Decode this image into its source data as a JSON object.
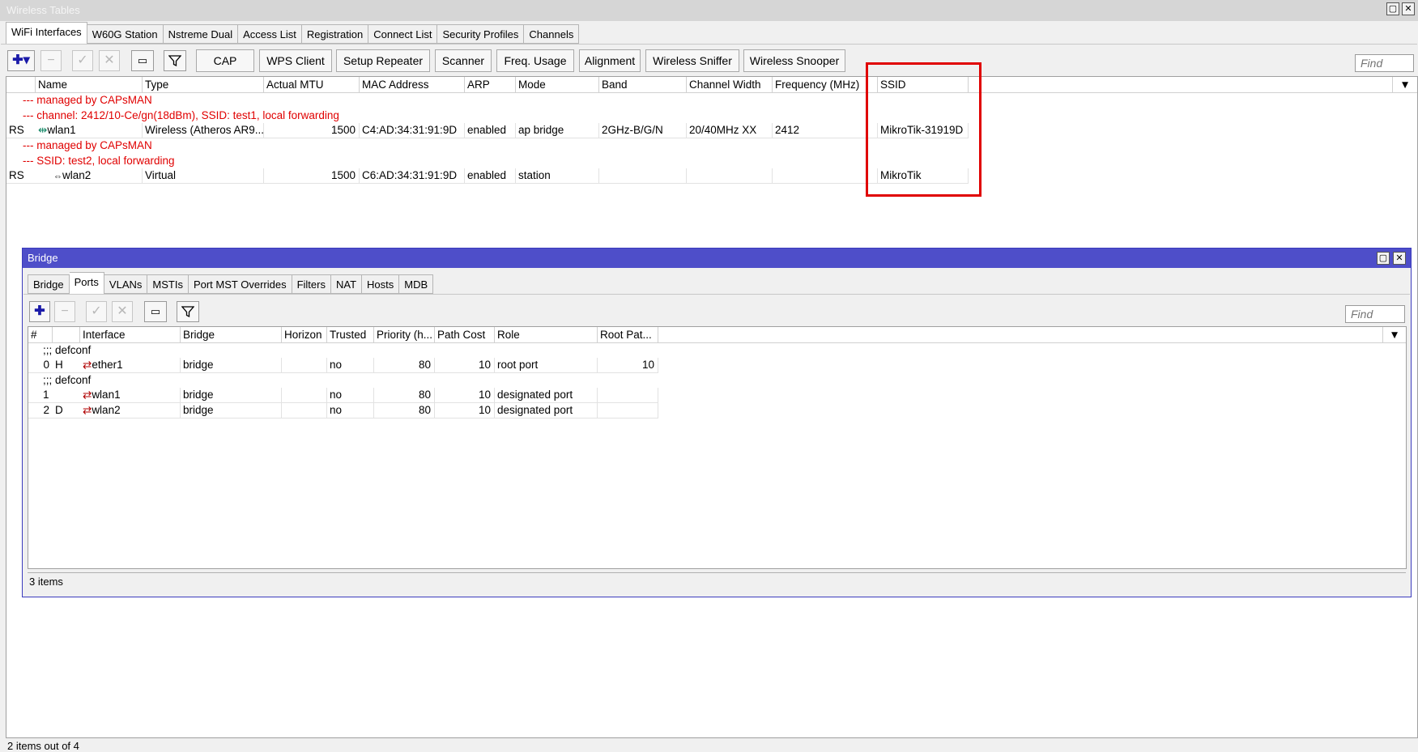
{
  "window": {
    "title": "Wireless Tables",
    "tabs": [
      "WiFi Interfaces",
      "W60G Station",
      "Nstreme Dual",
      "Access List",
      "Registration",
      "Connect List",
      "Security Profiles",
      "Channels"
    ],
    "toolbar": {
      "buttons": [
        "CAP",
        "WPS Client",
        "Setup Repeater",
        "Scanner",
        "Freq. Usage",
        "Alignment",
        "Wireless Sniffer",
        "Wireless Snooper"
      ],
      "find_placeholder": "Find"
    },
    "columns": [
      "Name",
      "Type",
      "Actual MTU",
      "MAC Address",
      "ARP",
      "Mode",
      "Band",
      "Channel Width",
      "Frequency (MHz)",
      "SSID"
    ],
    "comments": {
      "c1": "--- managed by CAPsMAN",
      "c2": "--- channel: 2412/10-Ce/gn(18dBm), SSID: test1, local forwarding",
      "c3": "--- managed by CAPsMAN",
      "c4": "--- SSID: test2, local forwarding"
    },
    "rows": [
      {
        "flags": "RS",
        "name": "wlan1",
        "type": "Wireless (Atheros AR9...",
        "mtu": "1500",
        "mac": "C4:AD:34:31:91:9D",
        "arp": "enabled",
        "mode": "ap bridge",
        "band": "2GHz-B/G/N",
        "width": "20/40MHz XX",
        "freq": "2412",
        "ssid": "MikroTik-31919D"
      },
      {
        "flags": "RS",
        "name": "wlan2",
        "type": "Virtual",
        "mtu": "1500",
        "mac": "C6:AD:34:31:91:9D",
        "arp": "enabled",
        "mode": "station",
        "band": "",
        "width": "",
        "freq": "",
        "ssid": "MikroTik"
      }
    ],
    "status": "2 items out of 4"
  },
  "bridge": {
    "title": "Bridge",
    "tabs": [
      "Bridge",
      "Ports",
      "VLANs",
      "MSTIs",
      "Port MST Overrides",
      "Filters",
      "NAT",
      "Hosts",
      "MDB"
    ],
    "find_placeholder": "Find",
    "columns": [
      "#",
      "Interface",
      "Bridge",
      "Horizon",
      "Trusted",
      "Priority (h...",
      "Path Cost",
      "Role",
      "Root Pat..."
    ],
    "comments": {
      "c1": ";;; defconf",
      "c2": ";;; defconf"
    },
    "rows": [
      {
        "num": "0",
        "flag": "H",
        "iface": "ether1",
        "bridge": "bridge",
        "horizon": "",
        "trusted": "no",
        "priority": "80",
        "cost": "10",
        "role": "root port",
        "rootcost": "10"
      },
      {
        "num": "1",
        "flag": "",
        "iface": "wlan1",
        "bridge": "bridge",
        "horizon": "",
        "trusted": "no",
        "priority": "80",
        "cost": "10",
        "role": "designated port",
        "rootcost": ""
      },
      {
        "num": "2",
        "flag": "D",
        "iface": "wlan2",
        "bridge": "bridge",
        "horizon": "",
        "trusted": "no",
        "priority": "80",
        "cost": "10",
        "role": "designated port",
        "rootcost": ""
      }
    ],
    "status": "3 items"
  },
  "colors": {
    "highlight": "#e00000",
    "comment": "#e00000",
    "bridge_title": "#4e4ec9"
  }
}
